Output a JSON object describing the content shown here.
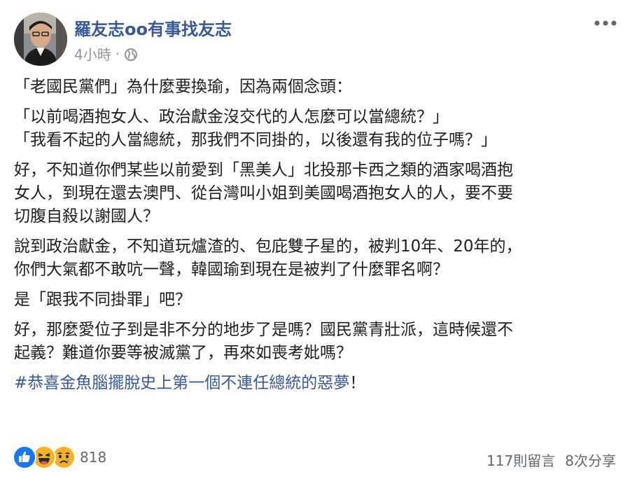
{
  "post": {
    "author_name": "羅友志oo有事找友志",
    "timestamp": "4小時",
    "separator": "·",
    "audience_icon": "globe-icon",
    "paragraphs": [
      "「老國民黨們」為什麼要換瑜，因為兩個念頭：",
      "「以前喝酒抱女人、政治獻金沒交代的人怎麼可以當總統？」",
      "「我看不起的人當總統，那我們不同掛的，以後還有我的位子嗎？」",
      "好，不知道你們某些以前愛到「黑美人」北投那卡西之類的酒家喝酒抱",
      "女人，到現在還去澳門、從台灣叫小姐到美國喝酒抱女人的人，要不要",
      "切腹自殺以謝國人？",
      "說到政治獻金，不知道玩爐渣的、包庇雙子星的，被判10年、20年的，",
      "你們大氣都不敢吭一聲，韓國瑜到現在是被判了什麼罪名啊？",
      "是「跟我不同掛罪」吧？",
      "好，那麼愛位子到是非不分的地步了是嗎？國民黨青壯派，這時候還不",
      "起義？難道你要等被滅黨了，再來如喪考妣嗎？"
    ],
    "hashtag": "#恭喜金魚腦擺脫史上第一個不連任總統的惡夢",
    "hashtag_suffix": "！"
  },
  "footer": {
    "reaction_icons": [
      "like-icon",
      "haha-icon",
      "sad-icon"
    ],
    "reaction_count": "818",
    "comments": "117則留言",
    "shares": "8次分享"
  },
  "colors": {
    "link_blue": "#385898",
    "text": "#1c1e21",
    "meta_gray": "#90949c",
    "like_blue": "#1877f2",
    "emoji_yellow": "#f7b125"
  }
}
